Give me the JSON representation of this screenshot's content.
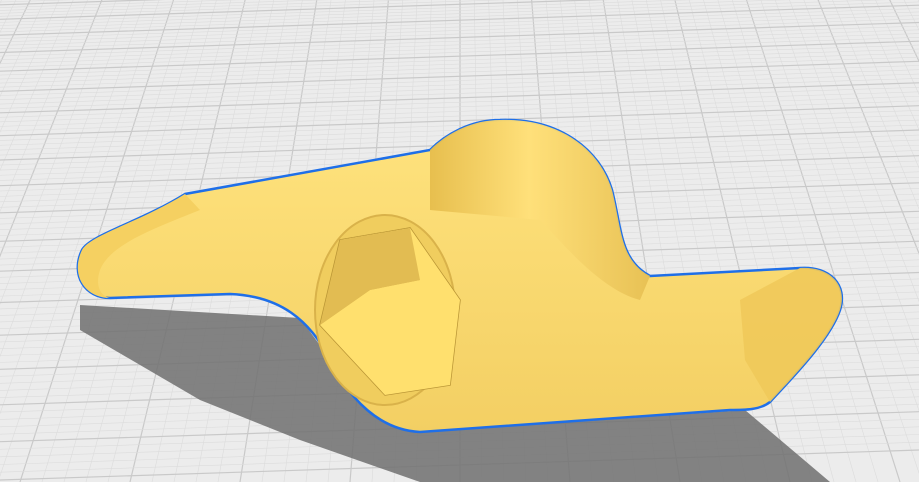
{
  "viewport": {
    "colors": {
      "background": "#ececec",
      "grid_major": "#c9c9c9",
      "grid_minor": "#dcdcdc",
      "model_fill": "#f7d56a",
      "model_shade": "#e8bf4e",
      "model_light": "#ffe37e",
      "outline": "#1f6fe8",
      "shadow": "#6e6e6e"
    }
  }
}
